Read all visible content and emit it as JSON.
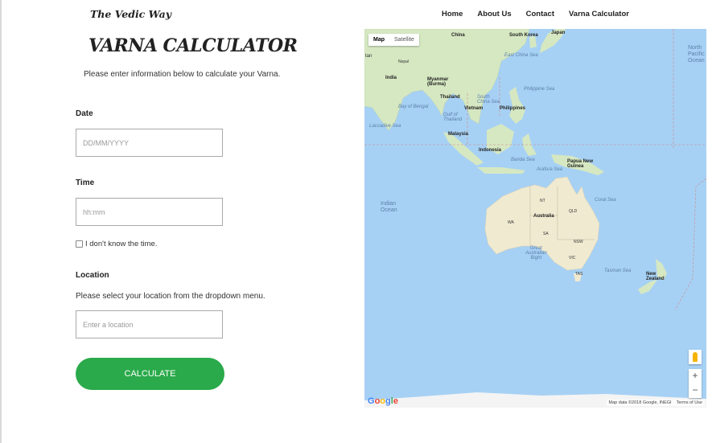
{
  "brand": "The Vedic Way",
  "nav": [
    "Home",
    "About Us",
    "Contact",
    "Varna Calculator"
  ],
  "title": "VARNA CALCULATOR",
  "intro": "Please enter information below to calculate your Varna.",
  "date": {
    "label": "Date",
    "placeholder": "DD/MM/YYYY"
  },
  "time": {
    "label": "Time",
    "placeholder": "hh:mm"
  },
  "unknown_time": "I don't know the time.",
  "location": {
    "label": "Location",
    "help": "Please select your location from the dropdown menu.",
    "placeholder": "Enter a location"
  },
  "calculate": "CALCULATE",
  "button_color": "#2aaa4a",
  "map": {
    "type_map": "Map",
    "type_satellite": "Satellite",
    "zoom_in": "+",
    "zoom_out": "−",
    "attribution": "Map data ©2018 Google, INEGI",
    "terms": "Terms of Use",
    "logo": "Google",
    "labels": {
      "china": "China",
      "south_korea": "South Korea",
      "japan": "Japan",
      "nepal": "Nepal",
      "india": "India",
      "myanmar": "Myanmar\n(Burma)",
      "east_china_sea": "East China Sea",
      "philippine_sea": "Philippine Sea",
      "thailand": "Thailand",
      "south_china_sea": "South\nChina Sea",
      "bay_of_bengal": "Bay of Bengal",
      "vietnam": "Vietnam",
      "philippines": "Philippines",
      "gulf_thailand": "Gulf of\nThailand",
      "laccadive_sea": "Laccadive Sea",
      "malaysia": "Malaysia",
      "indonesia": "Indonesia",
      "banda_sea": "Banda Sea",
      "papua": "Papua New\nGuinea",
      "arafura_sea": "Arafura Sea",
      "coral_sea": "Coral Sea",
      "indian_ocean": "Indian\nOcean",
      "australia": "Australia",
      "nt": "NT",
      "qld": "QLD",
      "wa": "WA",
      "sa": "SA",
      "nsw": "NSW",
      "vic": "VIC",
      "tas": "TAS",
      "great_bight": "Great\nAustralian\nBight",
      "tasman_sea": "Tasman Sea",
      "new_zealand": "New\nZealand",
      "north_pacific": "North\nPacific\nOcean",
      "nepal_side": "tan"
    }
  }
}
